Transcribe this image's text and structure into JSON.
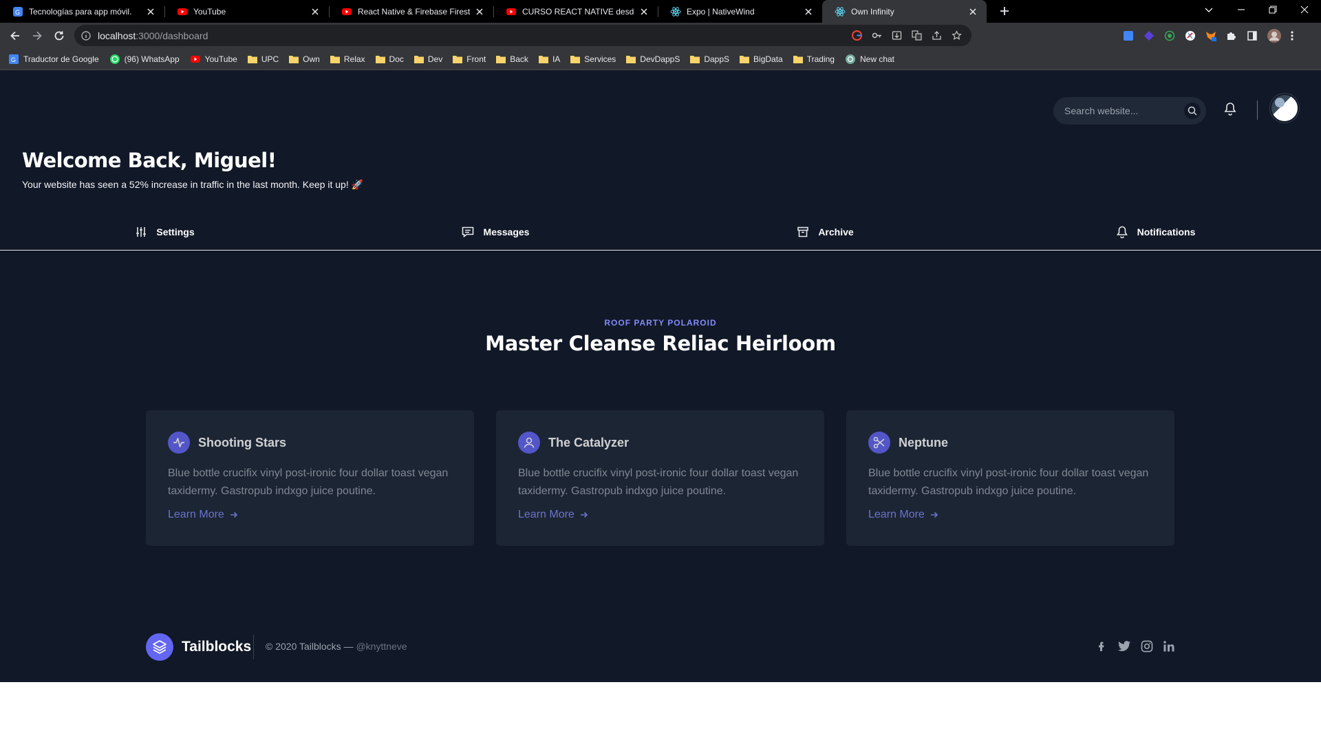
{
  "browser": {
    "tabs": [
      {
        "title": "Tecnologías para app móvil.",
        "favicon": "translate-icon",
        "active": false
      },
      {
        "title": "YouTube",
        "favicon": "youtube-icon",
        "active": false
      },
      {
        "title": "React Native & Firebase Firestore",
        "favicon": "youtube-icon",
        "active": false
      },
      {
        "title": "CURSO REACT NATIVE desde",
        "favicon": "youtube-icon",
        "active": false
      },
      {
        "title": "Expo | NativeWind",
        "favicon": "react-icon",
        "active": false
      },
      {
        "title": "Own Infinity",
        "favicon": "react-icon",
        "active": true
      }
    ],
    "url_host": "localhost",
    "url_path": ":3000/dashboard",
    "bookmarks": [
      {
        "label": "Traductor de Google",
        "icon": "translate-icon"
      },
      {
        "label": "(96) WhatsApp",
        "icon": "whatsapp-icon"
      },
      {
        "label": "YouTube",
        "icon": "youtube-icon"
      },
      {
        "label": "UPC",
        "icon": "folder-icon"
      },
      {
        "label": "Own",
        "icon": "folder-icon"
      },
      {
        "label": "Relax",
        "icon": "folder-icon"
      },
      {
        "label": "Doc",
        "icon": "folder-icon"
      },
      {
        "label": "Dev",
        "icon": "folder-icon"
      },
      {
        "label": "Front",
        "icon": "folder-icon"
      },
      {
        "label": "Back",
        "icon": "folder-icon"
      },
      {
        "label": "IA",
        "icon": "folder-icon"
      },
      {
        "label": "Services",
        "icon": "folder-icon"
      },
      {
        "label": "DevDappS",
        "icon": "folder-icon"
      },
      {
        "label": "DappS",
        "icon": "folder-icon"
      },
      {
        "label": "BigData",
        "icon": "folder-icon"
      },
      {
        "label": "Trading",
        "icon": "folder-icon"
      },
      {
        "label": "New chat",
        "icon": "openai-icon"
      }
    ]
  },
  "header": {
    "search_placeholder": "Search website...",
    "welcome": "Welcome Back, Miguel!",
    "subtitle": "Your website has seen a 52% increase in traffic in the last month. Keep it up! 🚀"
  },
  "tabs": [
    {
      "label": "Settings",
      "icon": "sliders-icon"
    },
    {
      "label": "Messages",
      "icon": "message-icon"
    },
    {
      "label": "Archive",
      "icon": "archive-icon"
    },
    {
      "label": "Notifications",
      "icon": "bell-icon"
    }
  ],
  "features": {
    "eyebrow": "ROOF PARTY POLAROID",
    "title": "Master Cleanse Reliac Heirloom",
    "cards": [
      {
        "title": "Shooting Stars",
        "text": "Blue bottle crucifix vinyl post-ironic four dollar toast vegan taxidermy. Gastropub indxgo juice poutine.",
        "link": "Learn More",
        "icon": "activity-icon"
      },
      {
        "title": "The Catalyzer",
        "text": "Blue bottle crucifix vinyl post-ironic four dollar toast vegan taxidermy. Gastropub indxgo juice poutine.",
        "link": "Learn More",
        "icon": "user-icon"
      },
      {
        "title": "Neptune",
        "text": "Blue bottle crucifix vinyl post-ironic four dollar toast vegan taxidermy. Gastropub indxgo juice poutine.",
        "link": "Learn More",
        "icon": "scissors-icon"
      }
    ]
  },
  "footer": {
    "brand": "Tailblocks",
    "copyright": "© 2020 Tailblocks —",
    "handle": "@knyttneve",
    "socials": [
      "facebook-icon",
      "twitter-icon",
      "instagram-icon",
      "linkedin-icon"
    ]
  },
  "colors": {
    "page_bg": "#111827",
    "card_bg": "#1f2937",
    "accent": "#6366f1",
    "accent_text": "#818cf8"
  }
}
